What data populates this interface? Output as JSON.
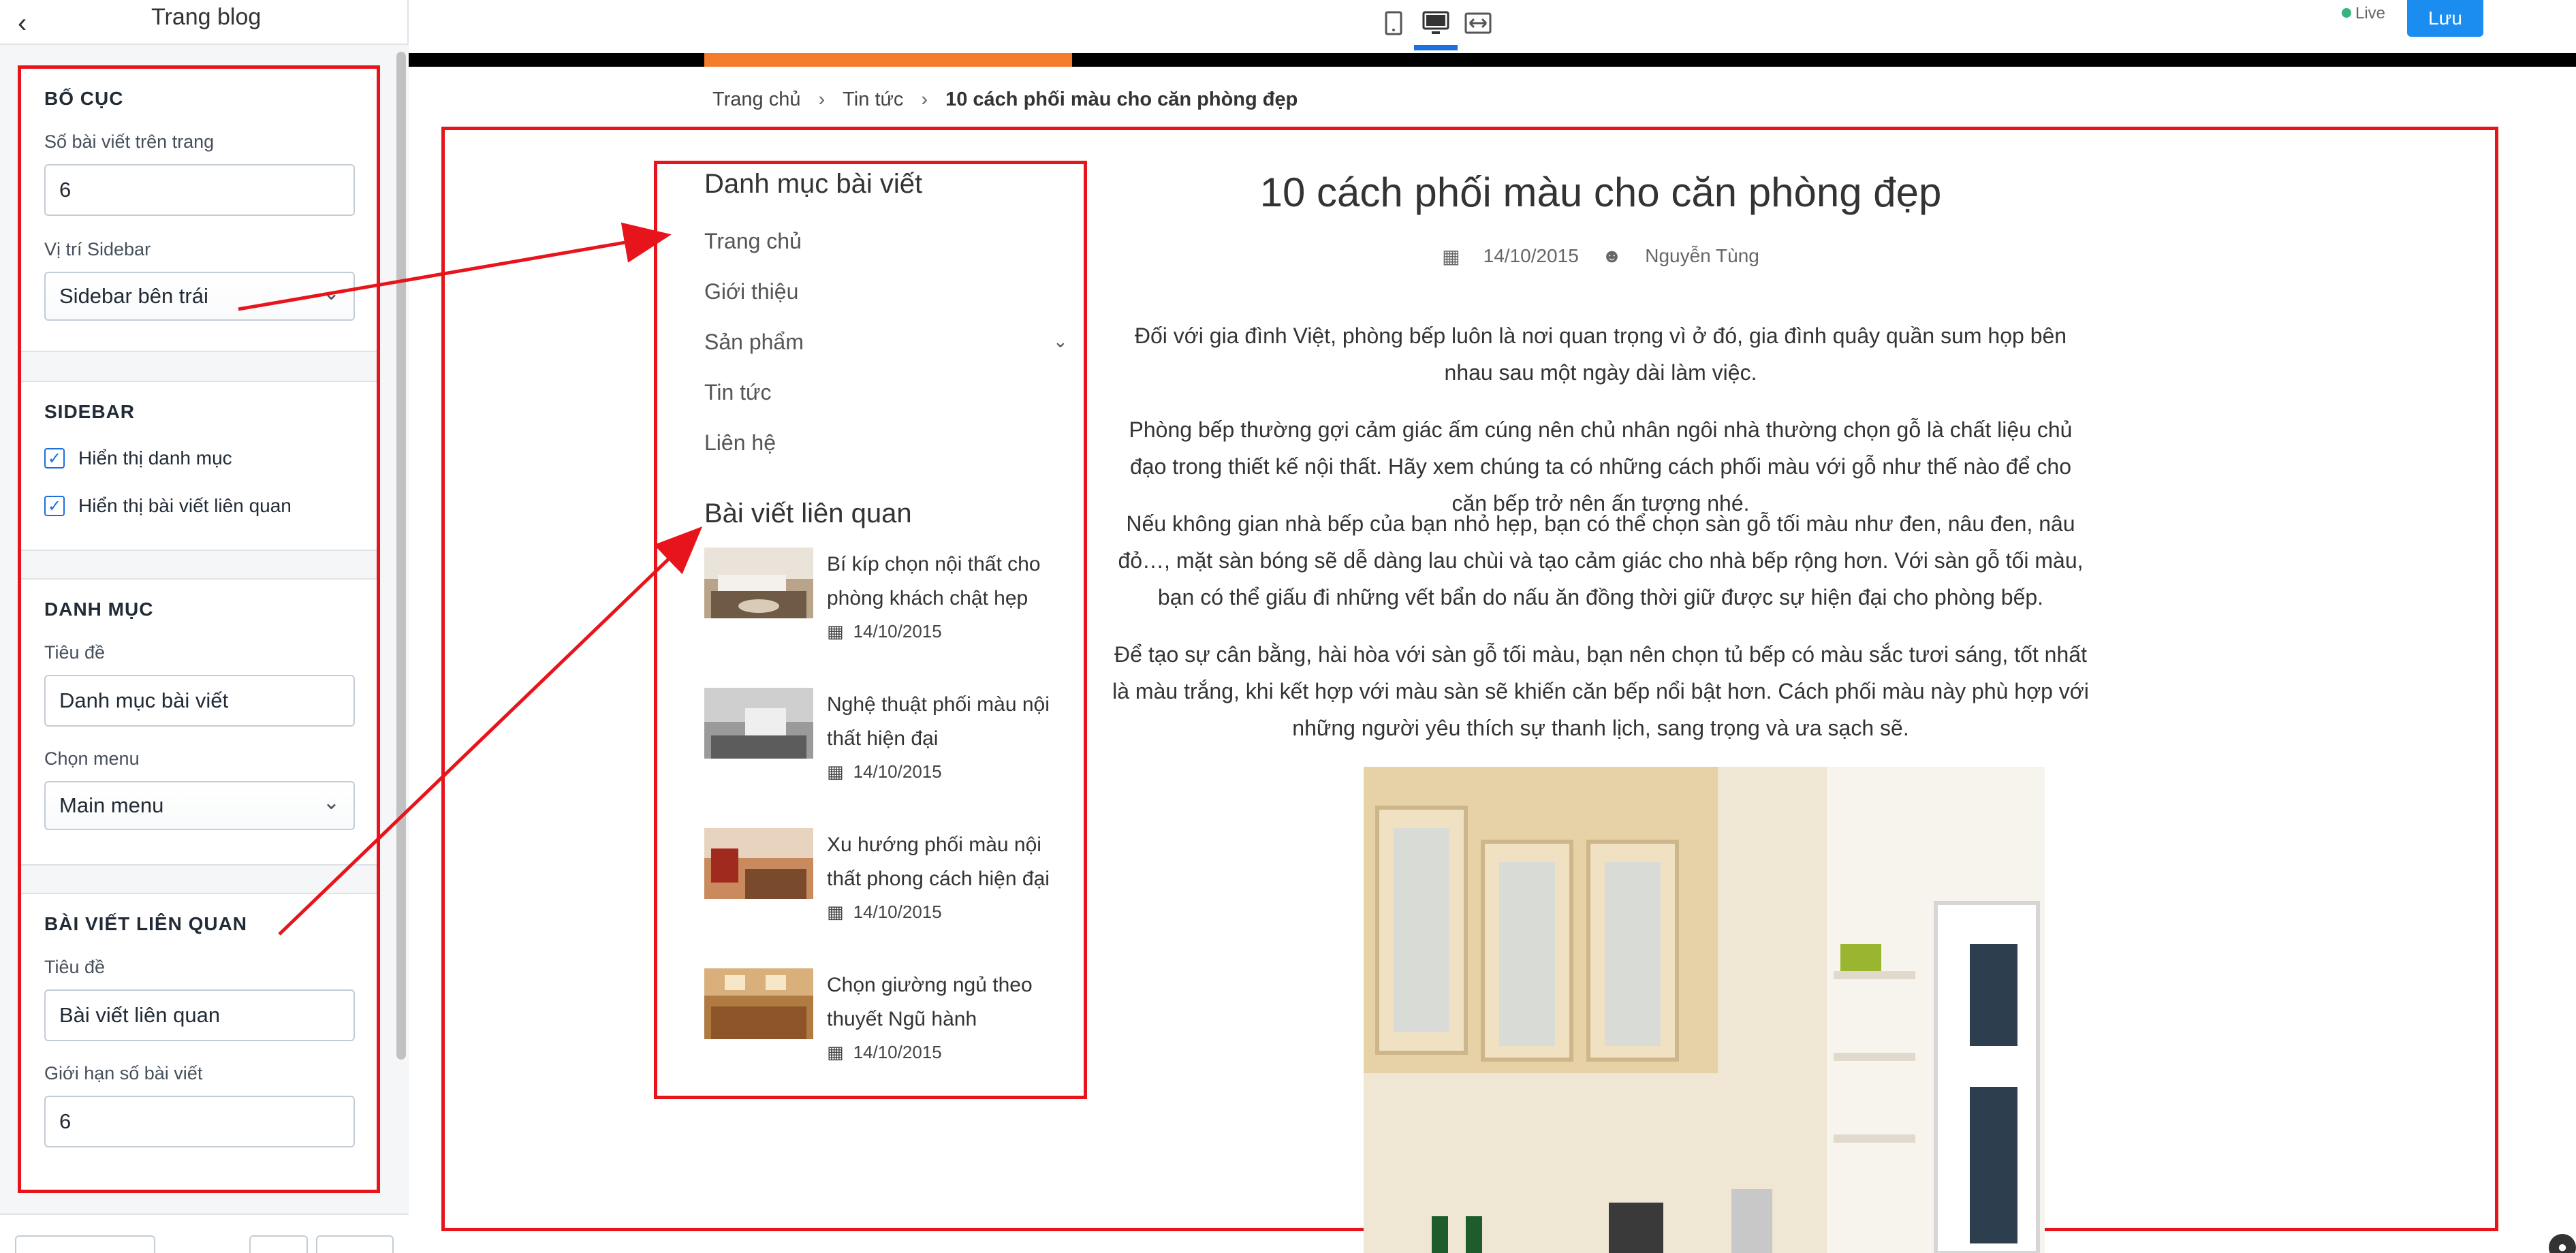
{
  "panel": {
    "title": "Trang blog",
    "sections": {
      "layout": {
        "title": "BỐ CỤC",
        "posts_per_page_label": "Số bài viết trên trang",
        "posts_per_page_value": "6",
        "sidebar_position_label": "Vị trí Sidebar",
        "sidebar_position_value": "Sidebar bên trái"
      },
      "sidebar": {
        "title": "SIDEBAR",
        "show_categories_label": "Hiển thị danh mục",
        "show_related_label": "Hiển thị bài viết liên quan"
      },
      "category": {
        "title": "DANH MỤC",
        "heading_label": "Tiêu đề",
        "heading_value": "Danh mục bài viết",
        "menu_label": "Chọn menu",
        "menu_value": "Main menu"
      },
      "related": {
        "title": "BÀI VIẾT LIÊN QUAN",
        "heading_label": "Tiêu đề",
        "heading_value": "Bài viết liên quan",
        "limit_label": "Giới hạn số bài viết",
        "limit_value": "6"
      }
    }
  },
  "toolbar": {
    "live_label": "Live",
    "save_label": "Lưu"
  },
  "breadcrumb": {
    "home": "Trang chủ",
    "news": "Tin tức",
    "current": "10 cách phối màu cho căn phòng đẹp"
  },
  "sidebar": {
    "category_heading": "Danh mục bài viết",
    "menu": [
      "Trang chủ",
      "Giới thiệu",
      "Sản phẩm",
      "Tin tức",
      "Liên hệ"
    ],
    "related_heading": "Bài viết liên quan",
    "related_posts": [
      {
        "title": "Bí kíp chọn nội thất cho phòng khách chật hẹp",
        "date": "14/10/2015"
      },
      {
        "title": "Nghệ thuật phối màu nội thất hiện đại",
        "date": "14/10/2015"
      },
      {
        "title": "Xu hướng phối màu nội thất phong cách hiện đại",
        "date": "14/10/2015"
      },
      {
        "title": "Chọn giường ngủ theo thuyết Ngũ hành",
        "date": "14/10/2015"
      }
    ]
  },
  "article": {
    "title": "10 cách phối màu cho căn phòng đẹp",
    "date": "14/10/2015",
    "author": "Nguyễn Tùng",
    "paragraphs": [
      "Đối với gia đình Việt, phòng bếp luôn là nơi quan trọng vì ở đó, gia đình quây quần sum họp bên nhau sau một ngày dài làm việc.",
      "Phòng bếp thường gợi cảm giác ấm cúng nên chủ nhân ngôi nhà thường chọn gỗ là chất liệu chủ đạo trong thiết kế nội thất. Hãy xem chúng ta có những cách phối màu với gỗ như thế nào để cho căn bếp trở nên ấn tượng nhé.",
      "Nếu không gian nhà bếp của bạn nhỏ hẹp, bạn có thể chọn sàn gỗ tối màu như đen, nâu đen, nâu đỏ…, mặt sàn bóng sẽ dễ dàng lau chùi và tạo cảm giác cho nhà bếp rộng hơn. Với sàn gỗ tối màu, bạn có thể giấu đi những vết bẩn do nấu ăn đồng thời giữ được sự hiện đại cho phòng bếp.",
      "Để tạo sự cân bằng, hài hòa với sàn gỗ tối màu, bạn nên chọn tủ bếp có màu sắc tươi sáng, tốt nhất là màu trắng, khi kết hợp với màu sàn sẽ khiến căn bếp nổi bật hơn. Cách phối màu này phù hợp với những người yêu thích sự thanh lịch, sang trọng và ưa sạch sẽ."
    ]
  },
  "colors": {
    "annotation_red": "#e8141b",
    "accent_blue": "#1b8cf0",
    "strip_orange": "#f47b2a"
  }
}
